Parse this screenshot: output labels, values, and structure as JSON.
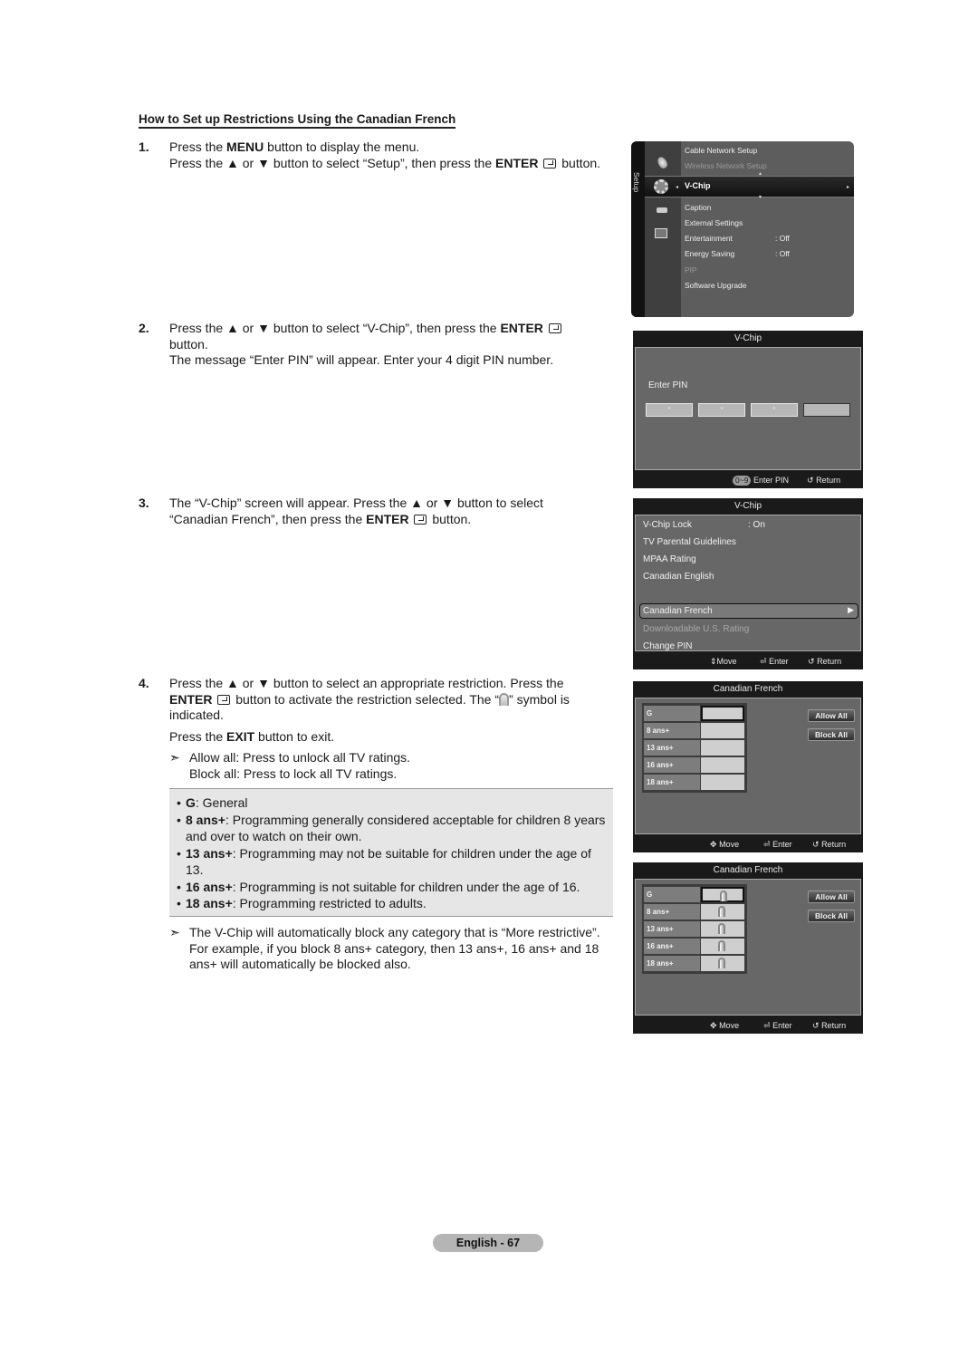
{
  "heading": "How to Set up Restrictions Using the Canadian French",
  "steps": [
    {
      "num": "1.",
      "lines": [
        {
          "pre": "Press the ",
          "bold": "MENU",
          "post": " button to display the menu."
        },
        {
          "pre": "Press the ▲ or ▼ button to select “Setup”, then press the ",
          "bold": "ENTER",
          "post": " button."
        }
      ]
    },
    {
      "num": "2.",
      "line1_pre": "Press the ▲ or ▼ button to select “V-Chip”, then press the ",
      "line1_bold": "ENTER",
      "line1_post": " button.",
      "line2": "The message “Enter PIN” will appear. Enter your 4 digit PIN number."
    },
    {
      "num": "3.",
      "line1": "The “V-Chip” screen will appear. Press the ▲ or ▼ button to select “Canadian French”, then press the ",
      "line1_bold": "ENTER",
      "line1_post": " button."
    },
    {
      "num": "4.",
      "line1_pre": "Press the ▲ or ▼ button to select an appropriate restriction. Press the ",
      "line1_bold": "ENTER",
      "line1_mid": " button to activate the restriction selected. The “",
      "line1_post": "” symbol is indicated.",
      "exit_pre": "Press the ",
      "exit_bold": "EXIT",
      "exit_post": " button to exit.",
      "note_arrow": "➣",
      "note_line1": "Allow all: Press to unlock all TV ratings.",
      "note_line2": "Block all: Press to lock all TV ratings."
    }
  ],
  "ratings": [
    {
      "code": "G",
      "desc": ": General"
    },
    {
      "code": "8 ans+",
      "desc": ": Programming generally considered acceptable for children 8 years and over to watch on their own."
    },
    {
      "code": "13 ans+",
      "desc": ": Programming may not be suitable for children under the age of 13."
    },
    {
      "code": "16 ans+",
      "desc": ": Programming is not suitable for children under the age of 16."
    },
    {
      "code": "18 ans+",
      "desc": ": Programming restricted to adults."
    }
  ],
  "footer_note": {
    "arrow": "➣",
    "text": "The V-Chip will automatically block any category that is “More restrictive”. For example, if you block 8 ans+ category, then 13 ans+, 16 ans+ and 18 ans+ will automatically be blocked also."
  },
  "page_label": "English - 67",
  "setup_menu": {
    "side_label": "Setup",
    "items": [
      {
        "label": "Cable Network Setup",
        "state": "normal"
      },
      {
        "label": "Wireless Network Setup",
        "state": "dim"
      },
      {
        "label": "V-Chip",
        "state": "selected"
      },
      {
        "label": "Caption",
        "state": "normal"
      },
      {
        "label": "External Settings",
        "state": "normal"
      },
      {
        "label": "Entertainment",
        "value": ": Off",
        "state": "normal"
      },
      {
        "label": "Energy Saving",
        "value": ": Off",
        "state": "normal"
      },
      {
        "label": "PIP",
        "state": "dim"
      },
      {
        "label": "Software Upgrade",
        "state": "normal"
      }
    ]
  },
  "pin_screen": {
    "title": "V-Chip",
    "label": "Enter PIN",
    "digits": [
      "*",
      "*",
      "*",
      ""
    ],
    "footer": {
      "badge": "0~9",
      "enter": "Enter PIN",
      "return": "Return"
    }
  },
  "vchip_screen": {
    "title": "V-Chip",
    "items": [
      {
        "label": "V-Chip Lock",
        "value": ": On",
        "state": "normal"
      },
      {
        "label": "TV Parental Guidelines",
        "state": "normal"
      },
      {
        "label": "MPAA Rating",
        "state": "normal"
      },
      {
        "label": "Canadian English",
        "state": "normal"
      },
      {
        "label": "Canadian French",
        "state": "selected"
      },
      {
        "label": "Downloadable U.S. Rating",
        "state": "dim"
      },
      {
        "label": "Change PIN",
        "state": "normal"
      }
    ],
    "footer": {
      "move": "Move",
      "enter": "Enter",
      "return": "Return"
    }
  },
  "cf_unlocked": {
    "title": "Canadian French",
    "rows": [
      {
        "label": "G",
        "locked": false
      },
      {
        "label": "8 ans+",
        "locked": false
      },
      {
        "label": "13 ans+",
        "locked": false
      },
      {
        "label": "16 ans+",
        "locked": false
      },
      {
        "label": "18 ans+",
        "locked": false
      }
    ],
    "allow_all": "Allow All",
    "block_all": "Block All",
    "footer": {
      "move": "Move",
      "enter": "Enter",
      "return": "Return"
    }
  },
  "cf_locked": {
    "title": "Canadian French",
    "rows": [
      {
        "label": "G",
        "locked": true
      },
      {
        "label": "8 ans+",
        "locked": true
      },
      {
        "label": "13 ans+",
        "locked": true
      },
      {
        "label": "16 ans+",
        "locked": true
      },
      {
        "label": "18 ans+",
        "locked": true
      }
    ],
    "allow_all": "Allow All",
    "block_all": "Block All",
    "footer": {
      "move": "Move",
      "enter": "Enter",
      "return": "Return"
    }
  },
  "icons": {
    "return": "↺",
    "move_updown": "⇕",
    "move_4way": "✥",
    "enter": "⏎",
    "arrow_right": "▶"
  }
}
